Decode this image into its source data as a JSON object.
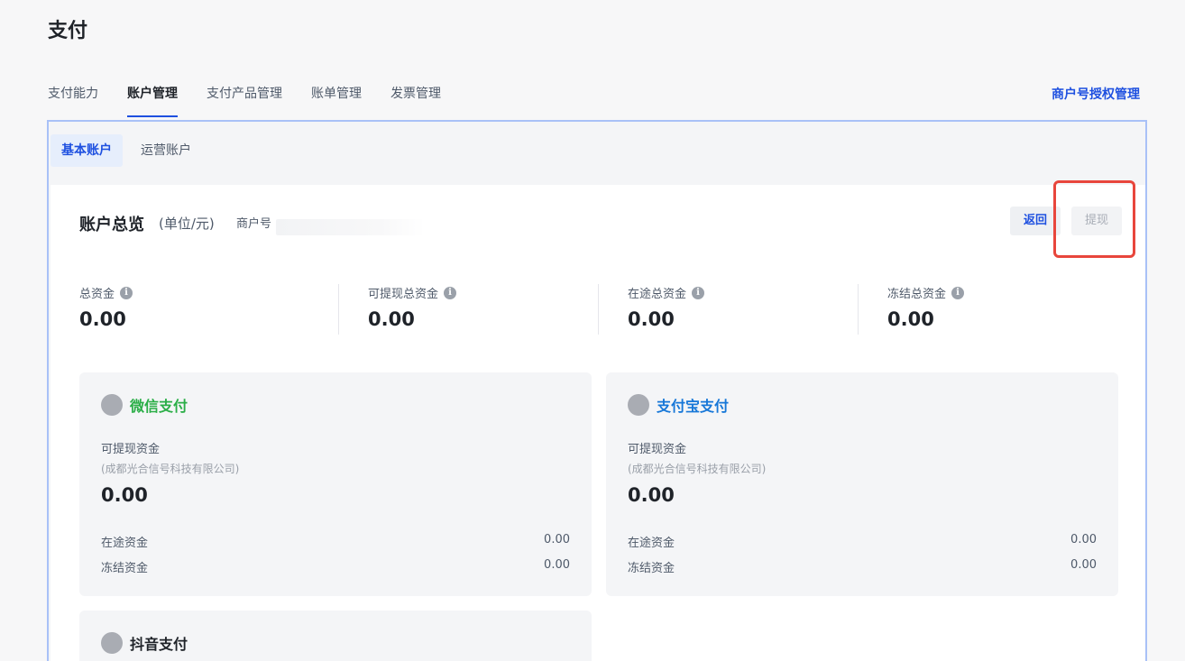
{
  "page": {
    "title": "支付"
  },
  "tabs": [
    {
      "label": "支付能力"
    },
    {
      "label": "账户管理"
    },
    {
      "label": "支付产品管理"
    },
    {
      "label": "账单管理"
    },
    {
      "label": "发票管理"
    }
  ],
  "active_tab": "账户管理",
  "top_link": "商户号授权管理",
  "subtabs": [
    {
      "label": "基本账户"
    },
    {
      "label": "运营账户"
    }
  ],
  "overview": {
    "title": "账户总览",
    "unit": "(单位/元)",
    "merchant_label": "商户号",
    "back_label": "返回",
    "withdraw_label": "提现",
    "stats": [
      {
        "label": "总资金",
        "value": "0.00"
      },
      {
        "label": "可提现总资金",
        "value": "0.00"
      },
      {
        "label": "在途总资金",
        "value": "0.00"
      },
      {
        "label": "冻结总资金",
        "value": "0.00"
      }
    ]
  },
  "payments": [
    {
      "name": "微信支付",
      "available_label": "可提现资金",
      "company": "(成都光合信号科技有限公司)",
      "available_value": "0.00",
      "transit_label": "在途资金",
      "transit_value": "0.00",
      "frozen_label": "冻结资金",
      "frozen_value": "0.00"
    },
    {
      "name": "支付宝支付",
      "available_label": "可提现资金",
      "company": "(成都光合信号科技有限公司)",
      "available_value": "0.00",
      "transit_label": "在途资金",
      "transit_value": "0.00",
      "frozen_label": "冻结资金",
      "frozen_value": "0.00"
    },
    {
      "name": "抖音支付"
    }
  ],
  "colors": {
    "accent": "#1e50e0",
    "wechat": "#2aae47",
    "alipay": "#1677d8",
    "highlight": "#e8463c"
  }
}
